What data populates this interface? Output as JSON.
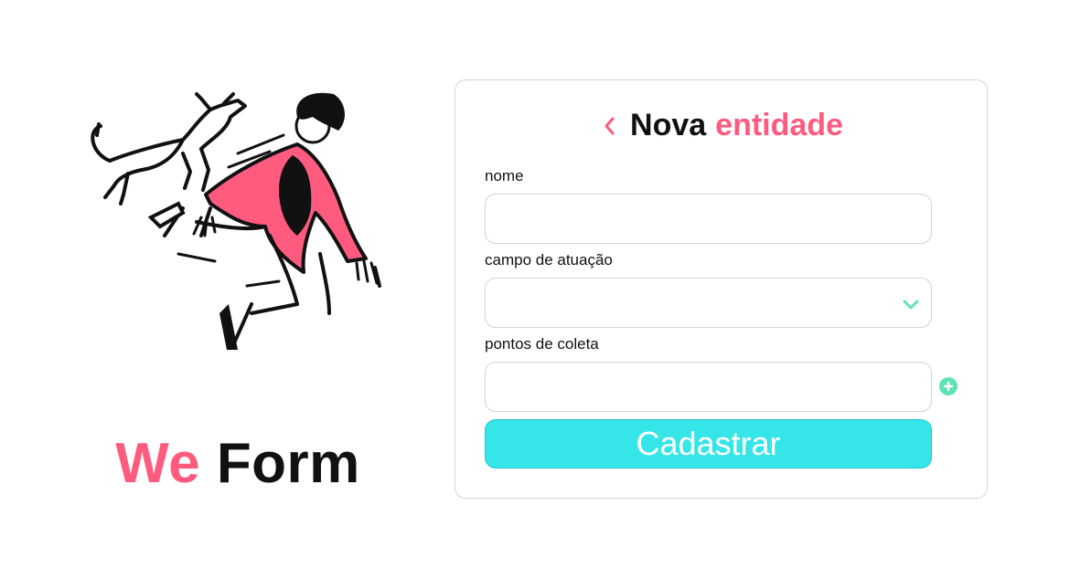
{
  "brand": {
    "part1": "We",
    "part2": "Form"
  },
  "form": {
    "title_part1": "Nova",
    "title_part2": "entidade",
    "fields": {
      "nome": {
        "label": "nome",
        "value": ""
      },
      "campo": {
        "label": "campo de atuação",
        "value": ""
      },
      "pontos": {
        "label": "pontos de coleta",
        "value": ""
      }
    },
    "submit_label": "Cadastrar"
  },
  "icons": {
    "back": "chevron-left-icon",
    "select": "chevron-down-icon",
    "add": "plus-circle-icon"
  },
  "colors": {
    "accent_pink": "#ff5b7f",
    "accent_teal": "#35e5e8",
    "accent_green": "#5fe3b4"
  }
}
